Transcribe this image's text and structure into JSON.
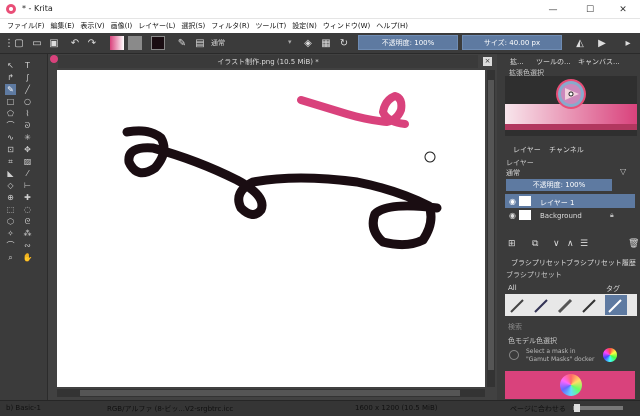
{
  "window": {
    "title": "* - Krita",
    "minimize": "—",
    "maximize": "☐",
    "close": "✕"
  },
  "menu": [
    "ファイル(F)",
    "編集(E)",
    "表示(V)",
    "画像(I)",
    "レイヤー(L)",
    "選択(S)",
    "フィルタ(R)",
    "ツール(T)",
    "設定(N)",
    "ウィンドウ(W)",
    "ヘルプ(H)"
  ],
  "toolbar": {
    "blend_mode": "通常",
    "opacity": "不透明度: 100%",
    "size": "サイズ: 40.00 px"
  },
  "document": {
    "tab_title": "イラスト制作.png (10.5 MiB) *"
  },
  "dock": {
    "tabs": [
      "拡...",
      "ツールの...",
      "キャンバス..."
    ],
    "color_selector_title": "拡張色選択",
    "layer_tabs": [
      "レイヤー",
      "チャンネル"
    ],
    "layer_label": "レイヤー",
    "blend_mode": "通常",
    "opacity": "不透明度: 100%",
    "layers": [
      {
        "name": "レイヤー 1"
      },
      {
        "name": "Background"
      }
    ],
    "brush_tabs": [
      "ブラシプリセット",
      "ブラシプリセット履歴"
    ],
    "brush_label": "ブラシプリセット",
    "brush_filter": "All",
    "tag": "タグ",
    "search_placeholder": "検索",
    "gamut_title": "色モデル色選択",
    "gamut_hint": "Select a mask in \"Gamut Masks\" docker"
  },
  "status": {
    "brush": "b) Basic-1",
    "color_space": "RGB/アルファ (8-ビッ...V2-srgbtrc.icc",
    "dimensions": "1600 x 1200 (10.5 MiB)",
    "zoom": "ページに合わせる"
  },
  "colors": {
    "foreground": "#1a0d12",
    "stroke_pink": "#d9427c",
    "accent": "#5e7aa1"
  }
}
